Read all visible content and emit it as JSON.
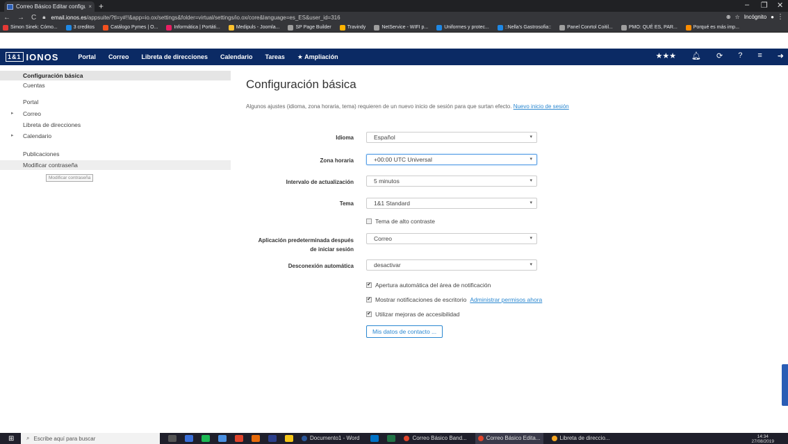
{
  "browser": {
    "tab_title": "Correo Básico Editar configuració",
    "tab_close": "×",
    "new_tab": "+",
    "url_host": "email.ionos.es",
    "url_path": "/appsuite/?tl=y#!!&app=io.ox/settings&folder=virtual/settings/io.ox/core&language=es_ES&user_id=316",
    "incognito_label": "Incógnito",
    "bookmarks": [
      {
        "label": "Simon Sinek: Cómo...",
        "color": "#e53935"
      },
      {
        "label": "3 creditos",
        "color": "#1e88e5"
      },
      {
        "label": "Catálogo Pymes | O...",
        "color": "#f4511e"
      },
      {
        "label": "Informática | Portáti...",
        "color": "#e91e63"
      },
      {
        "label": "Medipuls - Joomla...",
        "color": "#fbc02d"
      },
      {
        "label": "SP Page Builder",
        "color": "#9e9e9e"
      },
      {
        "label": "Travindy",
        "color": "#ffb300"
      },
      {
        "label": "NetService - WIFI p...",
        "color": "#9e9e9e"
      },
      {
        "label": "Uniformes y protec...",
        "color": "#1e88e5"
      },
      {
        "label": "::Nella's Gastrosofia::",
        "color": "#1e88e5"
      },
      {
        "label": "Panel Conrtol Coitil...",
        "color": "#9e9e9e"
      },
      {
        "label": "PMO: QUÉ ES, PAR...",
        "color": "#9e9e9e"
      },
      {
        "label": "Porqué es más imp...",
        "color": "#fb8c00"
      }
    ]
  },
  "app": {
    "logo_box": "1&1",
    "logo_text": "IONOS",
    "nav": [
      "Portal",
      "Correo",
      "Libreta de direcciones",
      "Calendario",
      "Tareas",
      "★ Ampliación"
    ],
    "header_stars": "★★★"
  },
  "sidebar": {
    "items": [
      {
        "label": "Configuración básica"
      },
      {
        "label": "Cuentas"
      },
      {
        "label": "Portal"
      },
      {
        "label": "Correo"
      },
      {
        "label": "Libreta de direcciones"
      },
      {
        "label": "Calendario"
      },
      {
        "label": "Publicaciones"
      },
      {
        "label": "Modificar contraseña"
      }
    ],
    "tooltip": "Modificar contraseña"
  },
  "main": {
    "title": "Configuración básica",
    "note": "Algunos ajustes (idioma, zona horaria, tema) requieren de un nuevo inicio de sesión para que surtan efecto.",
    "note_link": "Nuevo inicio de sesión",
    "fields": {
      "idioma": {
        "label": "Idioma",
        "value": "Español"
      },
      "zona": {
        "label": "Zona horaria",
        "value": "+00:00 UTC Universal"
      },
      "intervalo": {
        "label": "Intervalo de actualización",
        "value": "5 minutos"
      },
      "tema": {
        "label": "Tema",
        "value": "1&1 Standard"
      },
      "app_line1": "Aplicación predeterminada después",
      "app_line2": "de iniciar sesión",
      "app_value": "Correo",
      "desconexion": {
        "label": "Desconexión automática",
        "value": "desactivar"
      }
    },
    "checkboxes": {
      "alto_contraste": {
        "label": "Tema de alto contraste",
        "checked": false
      },
      "apertura": {
        "label": "Apertura automática del área de notificación",
        "checked": true
      },
      "notif": {
        "label": "Mostrar notificaciones de escritorio",
        "checked": true,
        "link": "Administrar permisos ahora"
      },
      "accesibilidad": {
        "label": "Utilizar mejoras de accesibilidad",
        "checked": true
      }
    },
    "contact_button": "Mis datos de contacto ..."
  },
  "taskbar": {
    "search_placeholder": "Escribe aquí para buscar",
    "apps": [
      {
        "label": "Documento1 - Word",
        "active": false
      },
      {
        "label": "Correo Básico Band...",
        "active": false
      },
      {
        "label": "Correo Básico Edita...",
        "active": true
      },
      {
        "label": "Libreta de direccio...",
        "active": false
      }
    ],
    "time": "14:34",
    "date": "27/08/2019"
  }
}
